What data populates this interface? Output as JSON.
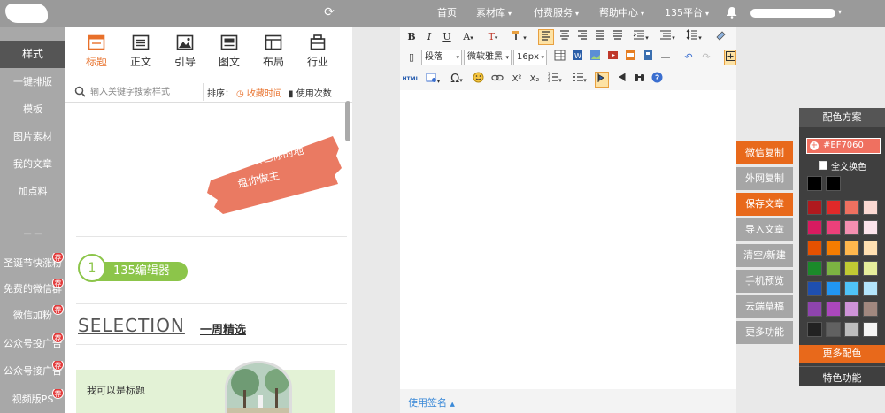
{
  "topbar": {
    "nav": [
      {
        "label": "首页",
        "caret": false
      },
      {
        "label": "素材库",
        "caret": true
      },
      {
        "label": "付费服务",
        "caret": true
      },
      {
        "label": "帮助中心",
        "caret": true
      },
      {
        "label": "135平台",
        "caret": true
      }
    ],
    "caret": "▾"
  },
  "sidebar": {
    "items": [
      "样式",
      "一键排版",
      "模板",
      "图片素材",
      "我的文章",
      "加点料"
    ],
    "promos": [
      {
        "label": "圣诞节快涨粉",
        "badge": "荐"
      },
      {
        "label": "免费的微信群",
        "badge": "荐"
      },
      {
        "label": "微信加粉",
        "badge": "荐"
      },
      {
        "label": "公众号投广告",
        "badge": "荐"
      },
      {
        "label": "公众号接广告",
        "badge": "荐"
      },
      {
        "label": "视频版PS",
        "badge": "荐"
      }
    ]
  },
  "style_panel": {
    "tabs": [
      "标题",
      "正文",
      "引导",
      "图文",
      "布局",
      "行业"
    ],
    "search_placeholder": "输入关键字搜索样式",
    "sort_label": "排序：",
    "sort_fav": "收藏时间",
    "sort_use": "使用次数",
    "card1": {
      "line1": "肆意",
      "line2": "青春，背景色你的地",
      "line3": "盘你做主"
    },
    "card2": {
      "number": "1",
      "text": "135编辑器"
    },
    "card3": {
      "en": "SELECTION",
      "cn": "一周精选"
    },
    "card4": {
      "title": "我可以是标题"
    }
  },
  "editor": {
    "row1": {
      "bold": "B",
      "italic": "I",
      "underline": "U",
      "fontcolor": "A",
      "bgcolor": "T"
    },
    "row2": {
      "paragraph": "段落",
      "font": "微软雅黑",
      "size": "16px"
    },
    "row3": {
      "html": "HTML",
      "omega": "Ω",
      "sup": "X²",
      "sub": "X₂"
    },
    "signature_label": "使用签名",
    "signature_caret": "▲"
  },
  "actions": [
    {
      "label": "微信复制",
      "style": "orange"
    },
    {
      "label": "外网复制",
      "style": "gray"
    },
    {
      "label": "保存文章",
      "style": "orange"
    },
    {
      "label": "导入文章",
      "style": "gray"
    },
    {
      "label": "清空/新建",
      "style": "gray"
    },
    {
      "label": "手机预览",
      "style": "gray"
    },
    {
      "label": "云端草稿",
      "style": "gray"
    },
    {
      "label": "更多功能",
      "style": "gray"
    }
  ],
  "color_panel": {
    "title": "配色方案",
    "current_hex": "#EF7060",
    "full_text_label": "全文换色",
    "recent": [
      "#000000",
      "#000000"
    ],
    "palette": [
      [
        "#b0191e",
        "#e02929",
        "#ef7060",
        "#fbd9d3"
      ],
      [
        "#d81b60",
        "#ec407a",
        "#f48fb1",
        "#fce4ec"
      ],
      [
        "#e65100",
        "#f57c00",
        "#ffb74d",
        "#ffe0b2"
      ],
      [
        "#1b8a2a",
        "#7cb342",
        "#c0ca33",
        "#e6ee9c"
      ],
      [
        "#1e4fb0",
        "#2196f3",
        "#4fc3f7",
        "#b3e5fc"
      ],
      [
        "#8e44ad",
        "#ab47bc",
        "#ce93d8",
        "#a1887f"
      ],
      [
        "#222222",
        "#616161",
        "#bdbdbd",
        "#f5f5f5"
      ]
    ],
    "more_label": "更多配色",
    "special_label": "特色功能"
  }
}
